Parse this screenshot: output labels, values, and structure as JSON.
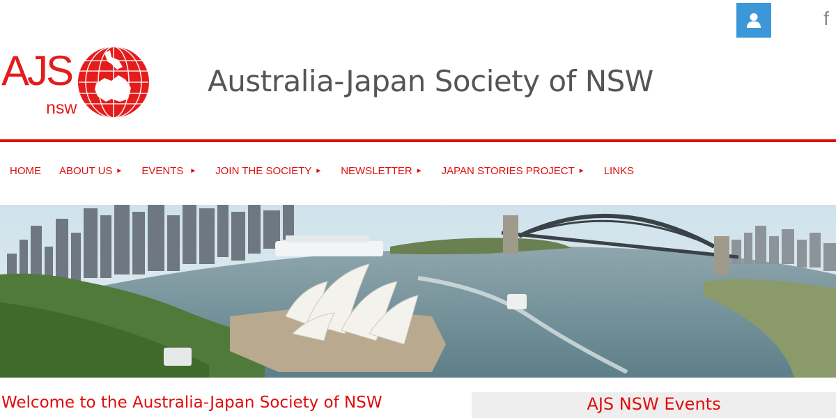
{
  "header": {
    "login_icon": "user-icon",
    "social_icon": "facebook-icon",
    "social_glyph": "f",
    "logo_text": "AJS",
    "logo_sub": "nsw",
    "site_title": "Australia-Japan Society of NSW"
  },
  "colors": {
    "brand_red": "#e00c0c",
    "login_blue": "#3b97d8",
    "title_gray": "#555555"
  },
  "nav": {
    "items": [
      {
        "label": "HOME",
        "has_submenu": false
      },
      {
        "label": "ABOUT US",
        "has_submenu": true
      },
      {
        "label": "EVENTS",
        "has_submenu": true
      },
      {
        "label": "JOIN THE SOCIETY",
        "has_submenu": true
      },
      {
        "label": "NEWSLETTER",
        "has_submenu": true
      },
      {
        "label": "JAPAN STORIES PROJECT",
        "has_submenu": true
      },
      {
        "label": "LINKS",
        "has_submenu": false
      }
    ],
    "submenu_arrow": "►"
  },
  "hero": {
    "image_subject": "sydney-harbour-opera-house-bridge"
  },
  "main": {
    "welcome_heading": "Welcome to the Australia-Japan Society of NSW"
  },
  "sidebar": {
    "events_heading": "AJS NSW Events"
  }
}
